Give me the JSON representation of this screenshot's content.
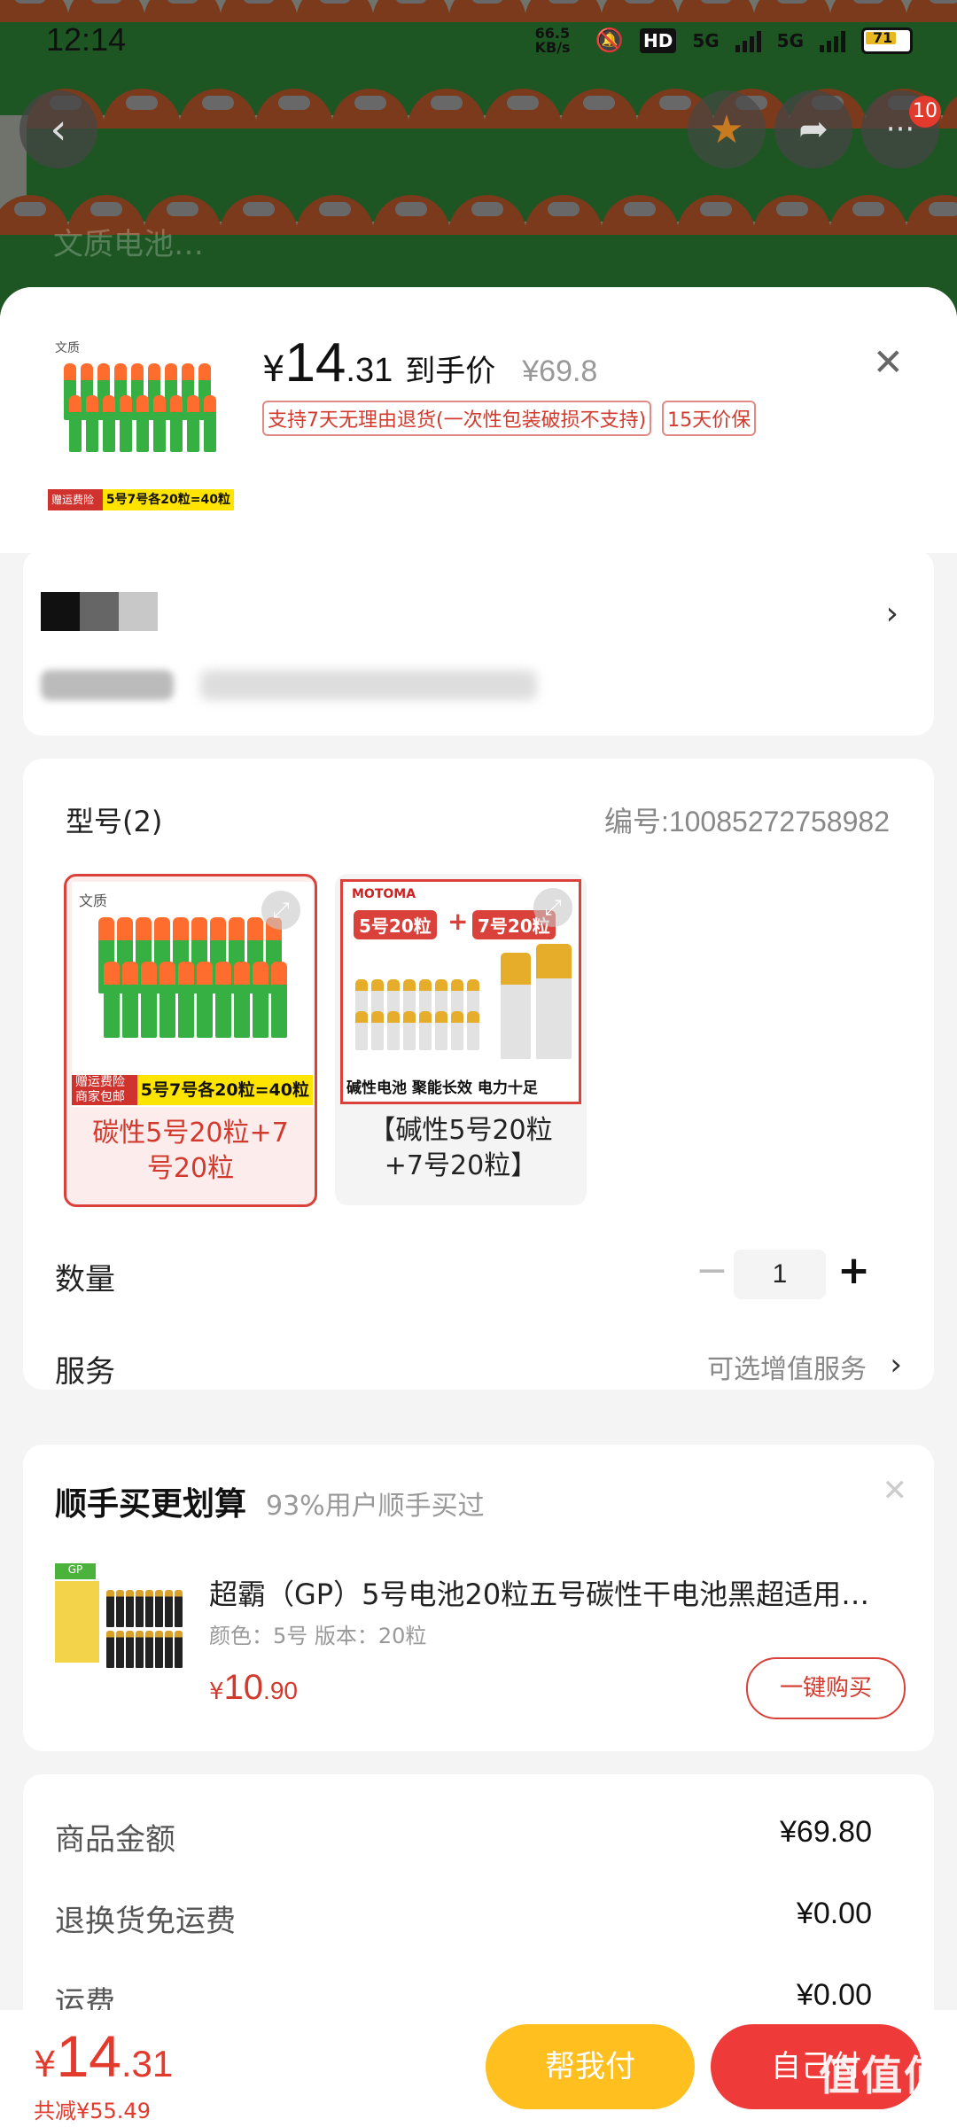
{
  "status_bar": {
    "time": "12:14",
    "net_speed": "66.5 KB/s",
    "hd": "HD",
    "sig1": "5G",
    "sig2": "5G",
    "battery": "71"
  },
  "nav": {
    "notif_count": "10"
  },
  "search_ghost": "文质电池…",
  "product": {
    "thumb_brand": "文质",
    "thumb_tag_a": "赠运费险 商家包邮",
    "thumb_tag_b": "5号7号各20粒=40粒",
    "price_symbol": "¥",
    "price_int": "14",
    "price_dec": ".31",
    "price_label": "到手价",
    "orig_price": "¥69.8",
    "badge_return": "支持7天无理由退货(一次性包装破损不支持)",
    "badge_protect": "15天价保"
  },
  "spec": {
    "heading": "型号(2)",
    "code": "编号:10085272758982",
    "options": [
      {
        "label": "碳性5号20粒+7号20粒",
        "brand": "文质",
        "tag_a": "赠运费险 商家包邮",
        "tag_b": "5号7号各20粒=40粒"
      },
      {
        "label": "【碱性5号20粒+7号20粒】",
        "brand": "MOTOMA",
        "promo_a": "5号20粒",
        "promo_b": "7号20粒",
        "footer": "碱性电池  聚能长效  电力十足"
      }
    ],
    "quantity_label": "数量",
    "quantity_value": "1",
    "service_label": "服务",
    "service_value": "可选增值服务"
  },
  "addon": {
    "title": "顺手买更划算",
    "subtitle": "93%用户顺手买过",
    "product_name": "超霸（GP）5号电池20粒五号碳性干电池黑超适用…",
    "attrs": "颜色：5号    版本：20粒",
    "price_symbol": "¥",
    "price_int": "10",
    "price_dec": ".90",
    "buy_label": "一键购买"
  },
  "summary": {
    "rows": [
      {
        "label": "商品金额",
        "value": "¥69.80"
      },
      {
        "label": "退换货免运费",
        "value": "¥0.00"
      },
      {
        "label": "运费",
        "value": "¥0.00"
      }
    ]
  },
  "bottom_bar": {
    "price_symbol": "¥",
    "price_int": "14",
    "price_dec": ".31",
    "saving": "共减¥55.49",
    "help_pay": "帮我付",
    "self_pay": "自己付",
    "watermark": "值值值"
  },
  "colors": {
    "accent_red": "#e23b2e",
    "help_yellow": "#ffbf1f"
  }
}
